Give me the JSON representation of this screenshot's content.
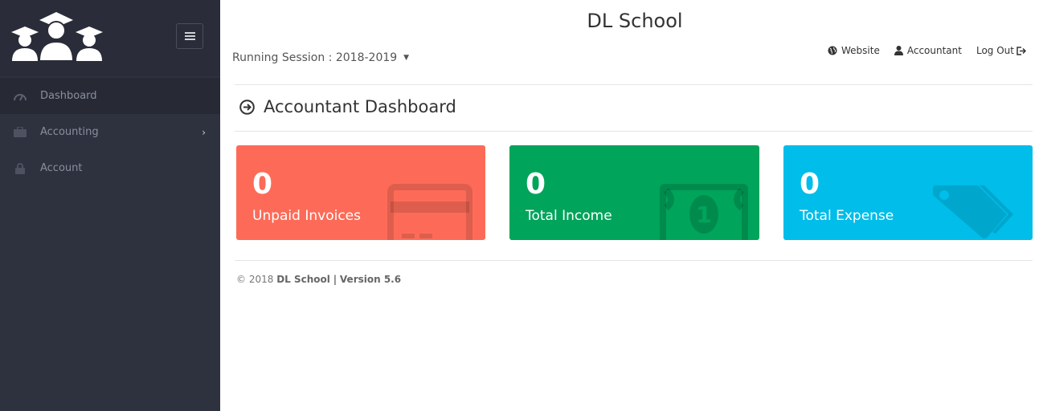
{
  "app": {
    "title": "DL School"
  },
  "sidebar": {
    "items": [
      {
        "label": "Dashboard",
        "icon": "dashboard-icon"
      },
      {
        "label": "Accounting",
        "icon": "briefcase-icon"
      },
      {
        "label": "Account",
        "icon": "lock-icon"
      }
    ]
  },
  "header": {
    "session_label": "Running Session : 2018-2019",
    "links": {
      "website": "Website",
      "user": "Accountant",
      "logout": "Log Out"
    }
  },
  "page": {
    "heading": "Accountant Dashboard"
  },
  "cards": [
    {
      "value": "0",
      "label": "Unpaid Invoices",
      "color": "#fd6b58",
      "icon": "invoice-icon"
    },
    {
      "value": "0",
      "label": "Total Income",
      "color": "#00a45b",
      "icon": "money-icon"
    },
    {
      "value": "0",
      "label": "Total Expense",
      "color": "#00bde9",
      "icon": "tags-icon"
    }
  ],
  "footer": {
    "copyright": "© 2018",
    "app_name": "DL School",
    "separator": "|",
    "version": "Version 5.6"
  },
  "colors": {
    "sidebar_bg": "#2e313e",
    "accent_red": "#fd6b58",
    "accent_green": "#00a45b",
    "accent_blue": "#00bde9"
  }
}
